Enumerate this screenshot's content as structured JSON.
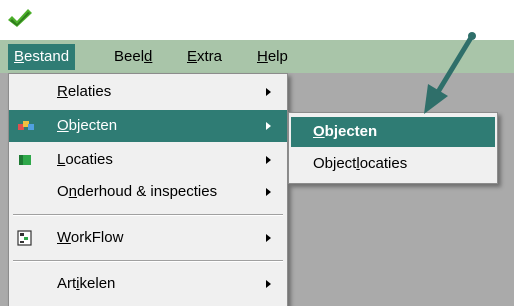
{
  "colors": {
    "menubar_bg": "#a9c5a9",
    "highlight": "#2f7c74",
    "workspace": "#aaaaaa",
    "menu_bg": "#f0f0f0",
    "annotation_arrow": "#2f6f6a"
  },
  "app": {
    "logo_icon": "green-checkmark-icon"
  },
  "menubar": {
    "items": [
      {
        "label": "Bestand",
        "mnemonic_index": 0,
        "active": true
      },
      {
        "label": "Beeld",
        "mnemonic_index": 4,
        "active": false
      },
      {
        "label": "Extra",
        "mnemonic_index": 0,
        "active": false
      },
      {
        "label": "Help",
        "mnemonic_index": 0,
        "active": false
      }
    ]
  },
  "dropdown": {
    "items": [
      {
        "label": "Relaties",
        "mnemonic_index": 0,
        "icon": "",
        "has_submenu": true,
        "highlight": false
      },
      {
        "label": "Objecten",
        "mnemonic_index": 0,
        "icon": "objects-icon",
        "has_submenu": true,
        "highlight": true
      },
      {
        "label": "Locaties",
        "mnemonic_index": 0,
        "icon": "locations-icon",
        "has_submenu": true,
        "highlight": false
      },
      {
        "label": "Onderhoud & inspecties",
        "mnemonic_index": 1,
        "icon": "",
        "has_submenu": true,
        "highlight": false
      },
      {
        "label": "WorkFlow",
        "mnemonic_index": 0,
        "icon": "workflow-icon",
        "has_submenu": true,
        "highlight": false
      },
      {
        "label": "Artikelen",
        "mnemonic_index": 3,
        "icon": "",
        "has_submenu": true,
        "highlight": false
      }
    ]
  },
  "submenu": {
    "items": [
      {
        "label": "Objecten",
        "mnemonic_index": 0,
        "highlight": true
      },
      {
        "label": "Objectlocaties",
        "mnemonic_index": 6,
        "highlight": false
      }
    ]
  }
}
